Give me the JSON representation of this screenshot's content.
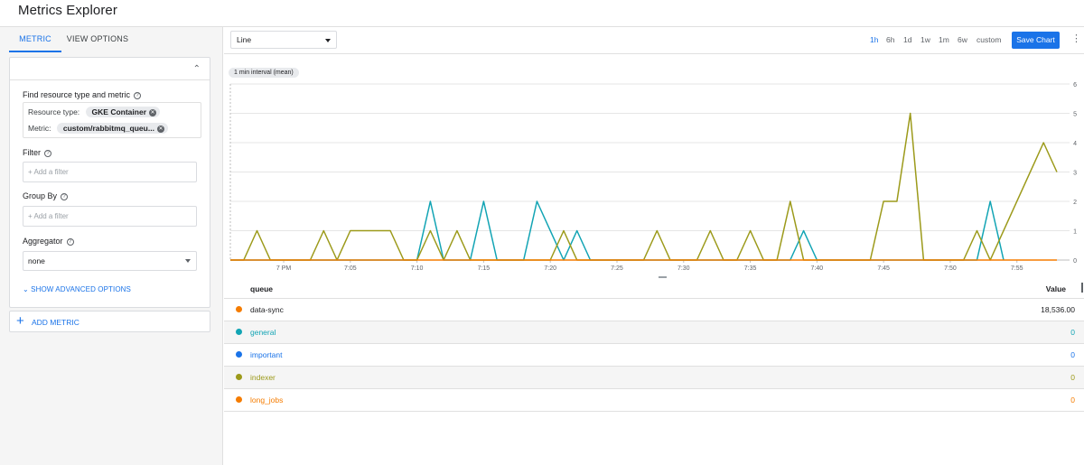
{
  "app": {
    "title": "Metrics Explorer"
  },
  "left": {
    "tabs": [
      {
        "label": "METRIC"
      },
      {
        "label": "VIEW OPTIONS"
      }
    ],
    "find_label": "Find resource type and metric",
    "resource_label": "Resource type:",
    "resource_value": "GKE Container",
    "metric_label": "Metric:",
    "metric_value": "custom/rabbitmq_queu...",
    "filter_label": "Filter",
    "filter_placeholder": "+ Add a filter",
    "groupby_label": "Group By",
    "groupby_placeholder": "+ Add a filter",
    "aggregator_label": "Aggregator",
    "aggregator_value": "none",
    "advanced_label": "SHOW ADVANCED OPTIONS",
    "add_metric_label": "ADD METRIC"
  },
  "toolbar": {
    "chart_type": "Line",
    "ranges": [
      "1h",
      "6h",
      "1d",
      "1w",
      "1m",
      "6w",
      "custom"
    ],
    "active_range": "1h",
    "save_label": "Save Chart"
  },
  "interval_chip": "1 min interval (mean)",
  "chart_data": {
    "type": "line",
    "xlim": [
      0,
      62
    ],
    "ylim": [
      0,
      6
    ],
    "x_ticks": [
      {
        "t": 4,
        "label": "7 PM"
      },
      {
        "t": 9,
        "label": "7:05"
      },
      {
        "t": 14,
        "label": "7:10"
      },
      {
        "t": 19,
        "label": "7:15"
      },
      {
        "t": 24,
        "label": "7:20"
      },
      {
        "t": 29,
        "label": "7:25"
      },
      {
        "t": 34,
        "label": "7:30"
      },
      {
        "t": 39,
        "label": "7:35"
      },
      {
        "t": 44,
        "label": "7:40"
      },
      {
        "t": 49,
        "label": "7:45"
      },
      {
        "t": 54,
        "label": "7:50"
      },
      {
        "t": 59,
        "label": "7:55"
      }
    ],
    "y_ticks": [
      0,
      1,
      2,
      3,
      4,
      5,
      6
    ],
    "grid": true,
    "series": [
      {
        "name": "general",
        "color": "#12a4b4",
        "points": [
          [
            0,
            0
          ],
          [
            14,
            0
          ],
          [
            15,
            2
          ],
          [
            16,
            0
          ],
          [
            18,
            0
          ],
          [
            19,
            2
          ],
          [
            20,
            0
          ],
          [
            22,
            0
          ],
          [
            23,
            2
          ],
          [
            25,
            0
          ],
          [
            26,
            1
          ],
          [
            27,
            0
          ],
          [
            42,
            0
          ],
          [
            43,
            1
          ],
          [
            44,
            0
          ],
          [
            56,
            0
          ],
          [
            57,
            2
          ],
          [
            58,
            0
          ]
        ]
      },
      {
        "name": "indexer",
        "color": "#9c9a1a",
        "points": [
          [
            0,
            0
          ],
          [
            1,
            0
          ],
          [
            2,
            1
          ],
          [
            3,
            0
          ],
          [
            6,
            0
          ],
          [
            7,
            1
          ],
          [
            8,
            0
          ],
          [
            9,
            1
          ],
          [
            12,
            1
          ],
          [
            13,
            0
          ],
          [
            14,
            0
          ],
          [
            15,
            1
          ],
          [
            16,
            0
          ],
          [
            17,
            1
          ],
          [
            18,
            0
          ],
          [
            24,
            0
          ],
          [
            25,
            1
          ],
          [
            26,
            0
          ],
          [
            31,
            0
          ],
          [
            32,
            1
          ],
          [
            33,
            0
          ],
          [
            35,
            0
          ],
          [
            36,
            1
          ],
          [
            37,
            0
          ],
          [
            38,
            0
          ],
          [
            39,
            1
          ],
          [
            40,
            0
          ],
          [
            41,
            0
          ],
          [
            42,
            2
          ],
          [
            43,
            0
          ],
          [
            48,
            0
          ],
          [
            49,
            2
          ],
          [
            50,
            2
          ],
          [
            51,
            5
          ],
          [
            52,
            0
          ],
          [
            55,
            0
          ],
          [
            56,
            1
          ],
          [
            57,
            0
          ],
          [
            61,
            4
          ],
          [
            62,
            3
          ]
        ]
      },
      {
        "name": "data-sync",
        "color": "#f57c00",
        "points": [
          [
            0,
            0
          ],
          [
            62,
            0
          ]
        ]
      }
    ]
  },
  "table": {
    "col_queue": "queue",
    "col_value": "Value",
    "rows": [
      {
        "name": "data-sync",
        "value": "18,536.00",
        "color": "#f57c00",
        "text_color": "#202124"
      },
      {
        "name": "general",
        "value": "0",
        "color": "#12a4b4",
        "text_color": "#12a4b4"
      },
      {
        "name": "important",
        "value": "0",
        "color": "#1a73e8",
        "text_color": "#1a73e8"
      },
      {
        "name": "indexer",
        "value": "0",
        "color": "#9c9a1a",
        "text_color": "#9c9a1a"
      },
      {
        "name": "long_jobs",
        "value": "0",
        "color": "#f57c00",
        "text_color": "#f57c00"
      }
    ]
  }
}
